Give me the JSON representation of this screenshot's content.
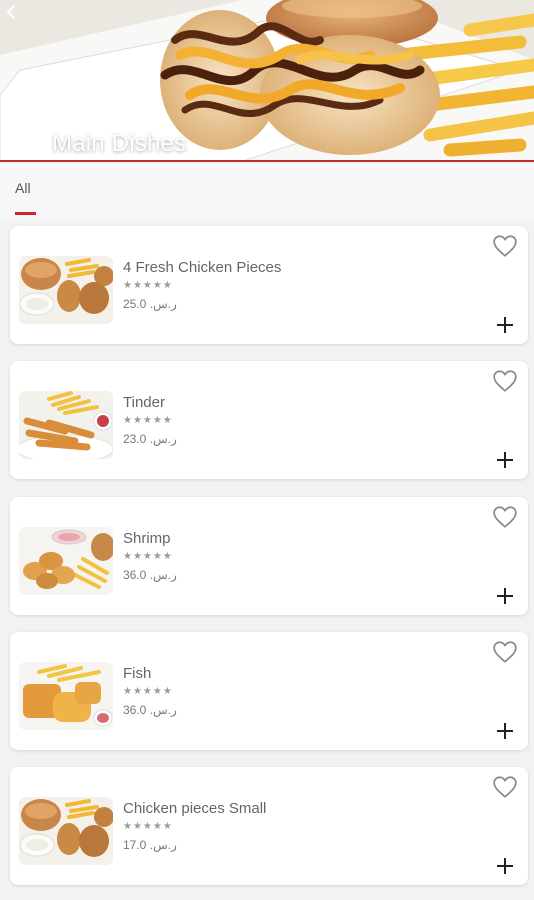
{
  "header": {
    "title": "Main Dishes",
    "back_icon": "chevron-left-icon"
  },
  "tabs": [
    {
      "label": "All",
      "active": true
    }
  ],
  "colors": {
    "accent": "#c8272c",
    "card_bg": "#ffffff",
    "page_bg": "#f2f2f2"
  },
  "products": [
    {
      "name": "4 Fresh Chicken Pieces",
      "rating": "★★★★★",
      "price": "25.0 .ر.س"
    },
    {
      "name": "Tinder",
      "rating": "★★★★★",
      "price": "23.0 .ر.س"
    },
    {
      "name": "Shrimp",
      "rating": "★★★★★",
      "price": "36.0 .ر.س"
    },
    {
      "name": "Fish",
      "rating": "★★★★★",
      "price": "36.0 .ر.س"
    },
    {
      "name": "Chicken pieces Small",
      "rating": "★★★★★",
      "price": "17.0 .ر.س"
    }
  ]
}
